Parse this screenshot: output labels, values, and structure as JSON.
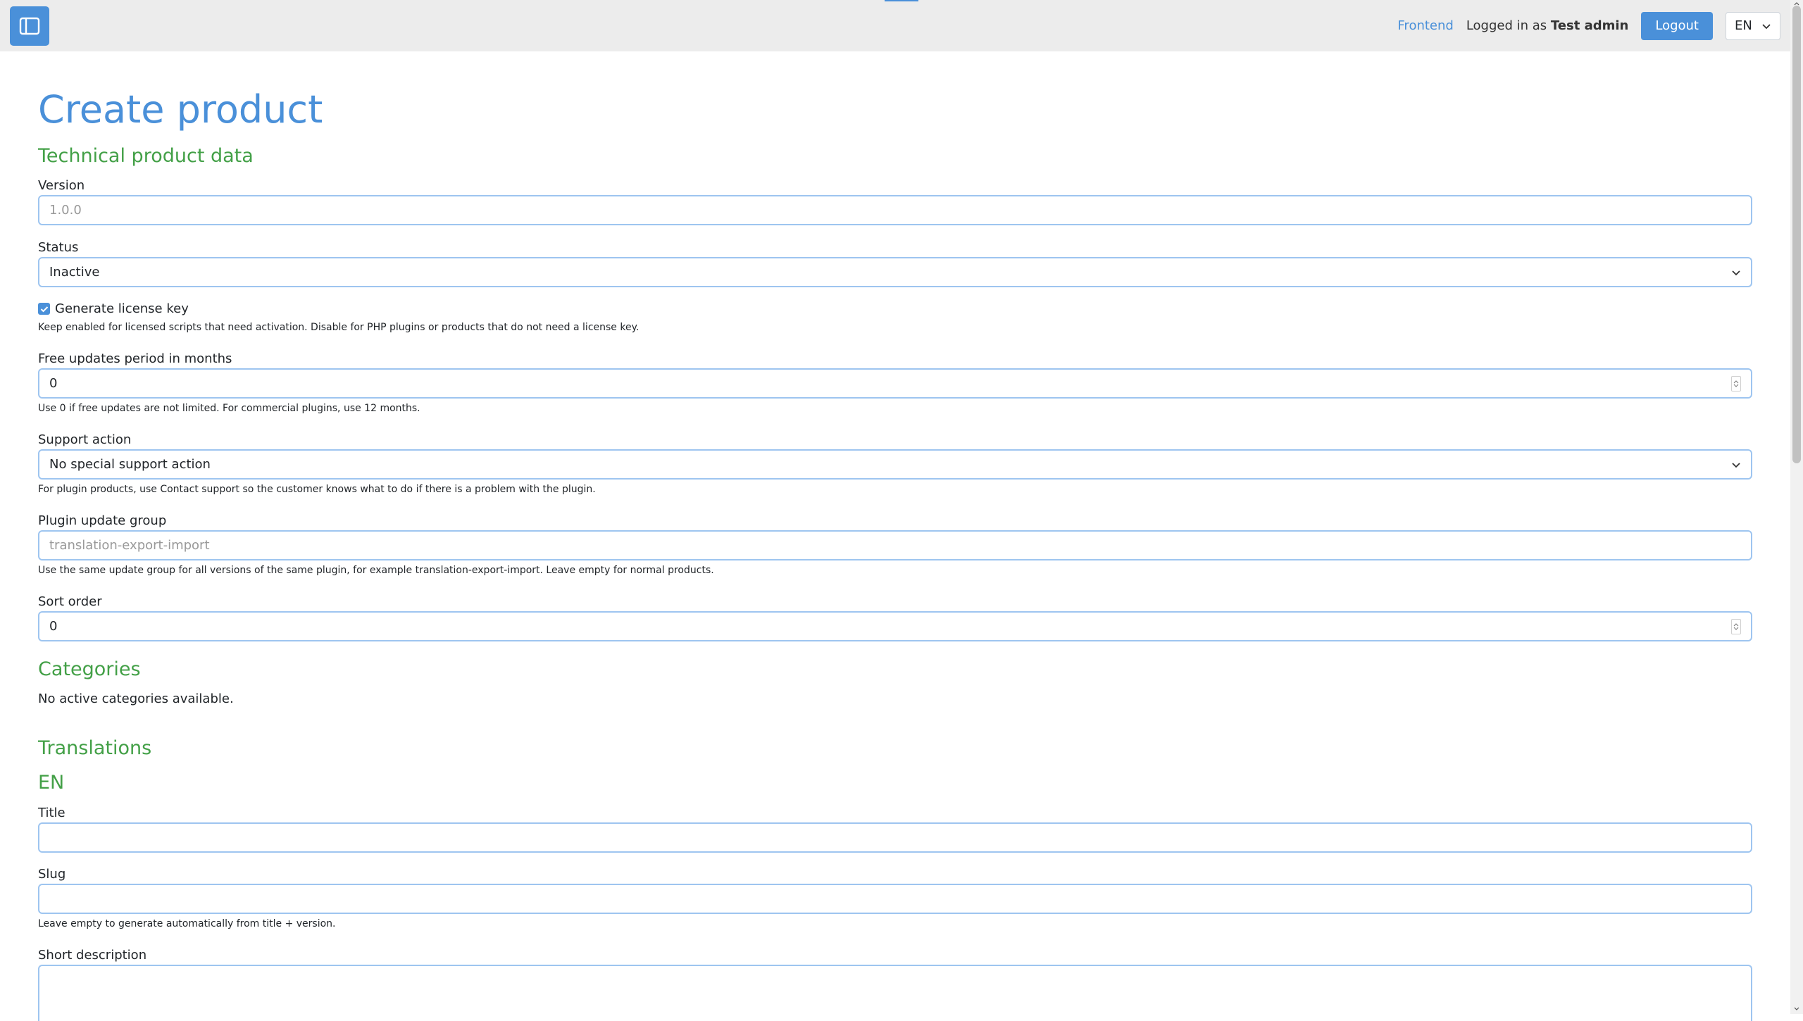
{
  "topbar": {
    "frontend_link": "Frontend",
    "logged_in_prefix": "Logged in as",
    "user_name": "Test admin",
    "logout_label": "Logout",
    "language_value": "EN"
  },
  "page": {
    "title": "Create product"
  },
  "technical": {
    "heading": "Technical product data",
    "version": {
      "label": "Version",
      "placeholder": "1.0.0",
      "value": ""
    },
    "status": {
      "label": "Status",
      "value": "Inactive"
    },
    "license": {
      "label": "Generate license key",
      "checked": true,
      "help": "Keep enabled for licensed scripts that need activation. Disable for PHP plugins or products that do not need a license key."
    },
    "free_updates": {
      "label": "Free updates period in months",
      "value": "0",
      "help": "Use 0 if free updates are not limited. For commercial plugins, use 12 months."
    },
    "support_action": {
      "label": "Support action",
      "value": "No special support action",
      "help": "For plugin products, use Contact support so the customer knows what to do if there is a problem with the plugin."
    },
    "plugin_group": {
      "label": "Plugin update group",
      "placeholder": "translation-export-import",
      "value": "",
      "help": "Use the same update group for all versions of the same plugin, for example translation-export-import. Leave empty for normal products."
    },
    "sort_order": {
      "label": "Sort order",
      "value": "0"
    }
  },
  "categories": {
    "heading": "Categories",
    "empty_message": "No active categories available."
  },
  "translations": {
    "heading": "Translations",
    "language_heading": "EN",
    "title_label": "Title",
    "slug_label": "Slug",
    "slug_help": "Leave empty to generate automatically from title + version.",
    "short_description_label": "Short description"
  },
  "colors": {
    "accent": "#4a90d9",
    "section_heading": "#43a047",
    "topbar_bg": "#ececec"
  }
}
